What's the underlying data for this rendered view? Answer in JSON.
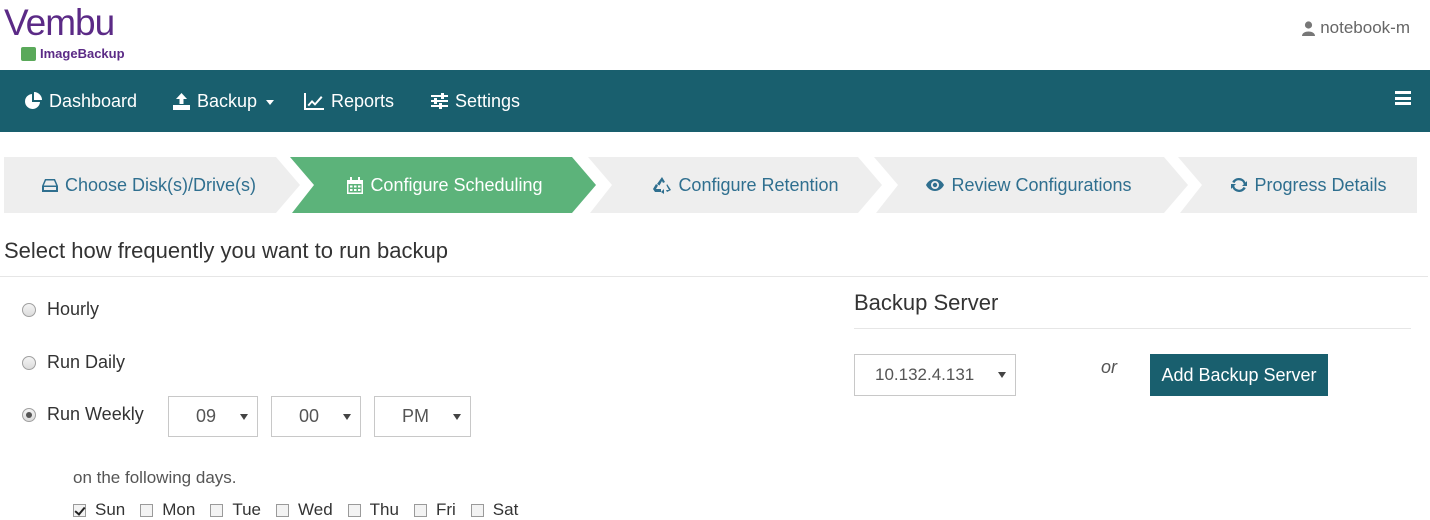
{
  "header": {
    "logo_brand": "Vembu",
    "logo_product": "ImageBackup",
    "user_name": "notebook-m"
  },
  "nav": {
    "items": [
      {
        "label": "Dashboard",
        "icon": "pie-chart-icon"
      },
      {
        "label": "Backup",
        "icon": "upload-icon"
      },
      {
        "label": "Reports",
        "icon": "line-chart-icon"
      },
      {
        "label": "Settings",
        "icon": "sliders-icon"
      }
    ],
    "menu_icon": "hamburger-icon"
  },
  "wizard": {
    "steps": [
      {
        "label": "Choose Disk(s)/Drive(s)",
        "icon": "hdd-icon",
        "active": false
      },
      {
        "label": "Configure Scheduling",
        "icon": "calendar-icon",
        "active": true
      },
      {
        "label": "Configure Retention",
        "icon": "recycle-icon",
        "active": false
      },
      {
        "label": "Review Configurations",
        "icon": "eye-icon",
        "active": false
      },
      {
        "label": "Progress Details",
        "icon": "refresh-icon",
        "active": false
      }
    ]
  },
  "schedule": {
    "title": "Select how frequently you want to run backup",
    "options": [
      {
        "label": "Hourly",
        "checked": false
      },
      {
        "label": "Run Daily",
        "checked": false
      },
      {
        "label": "Run Weekly",
        "checked": true
      }
    ],
    "hour": "09",
    "minute": "00",
    "ampm": "PM",
    "days_label": "on the following days.",
    "days": [
      {
        "label": "Sun",
        "checked": true
      },
      {
        "label": "Mon",
        "checked": false
      },
      {
        "label": "Tue",
        "checked": false
      },
      {
        "label": "Wed",
        "checked": false
      },
      {
        "label": "Thu",
        "checked": false
      },
      {
        "label": "Fri",
        "checked": false
      },
      {
        "label": "Sat",
        "checked": false
      }
    ]
  },
  "backup_server": {
    "title": "Backup Server",
    "selected": "10.132.4.131",
    "or_label": "or",
    "add_button": "Add Backup Server"
  },
  "colors": {
    "nav_bg": "#195f6e",
    "active_step": "#5cb37a",
    "inactive_step": "#eeeeee",
    "step_text": "#2f6f8f",
    "brand": "#5b2a86"
  }
}
